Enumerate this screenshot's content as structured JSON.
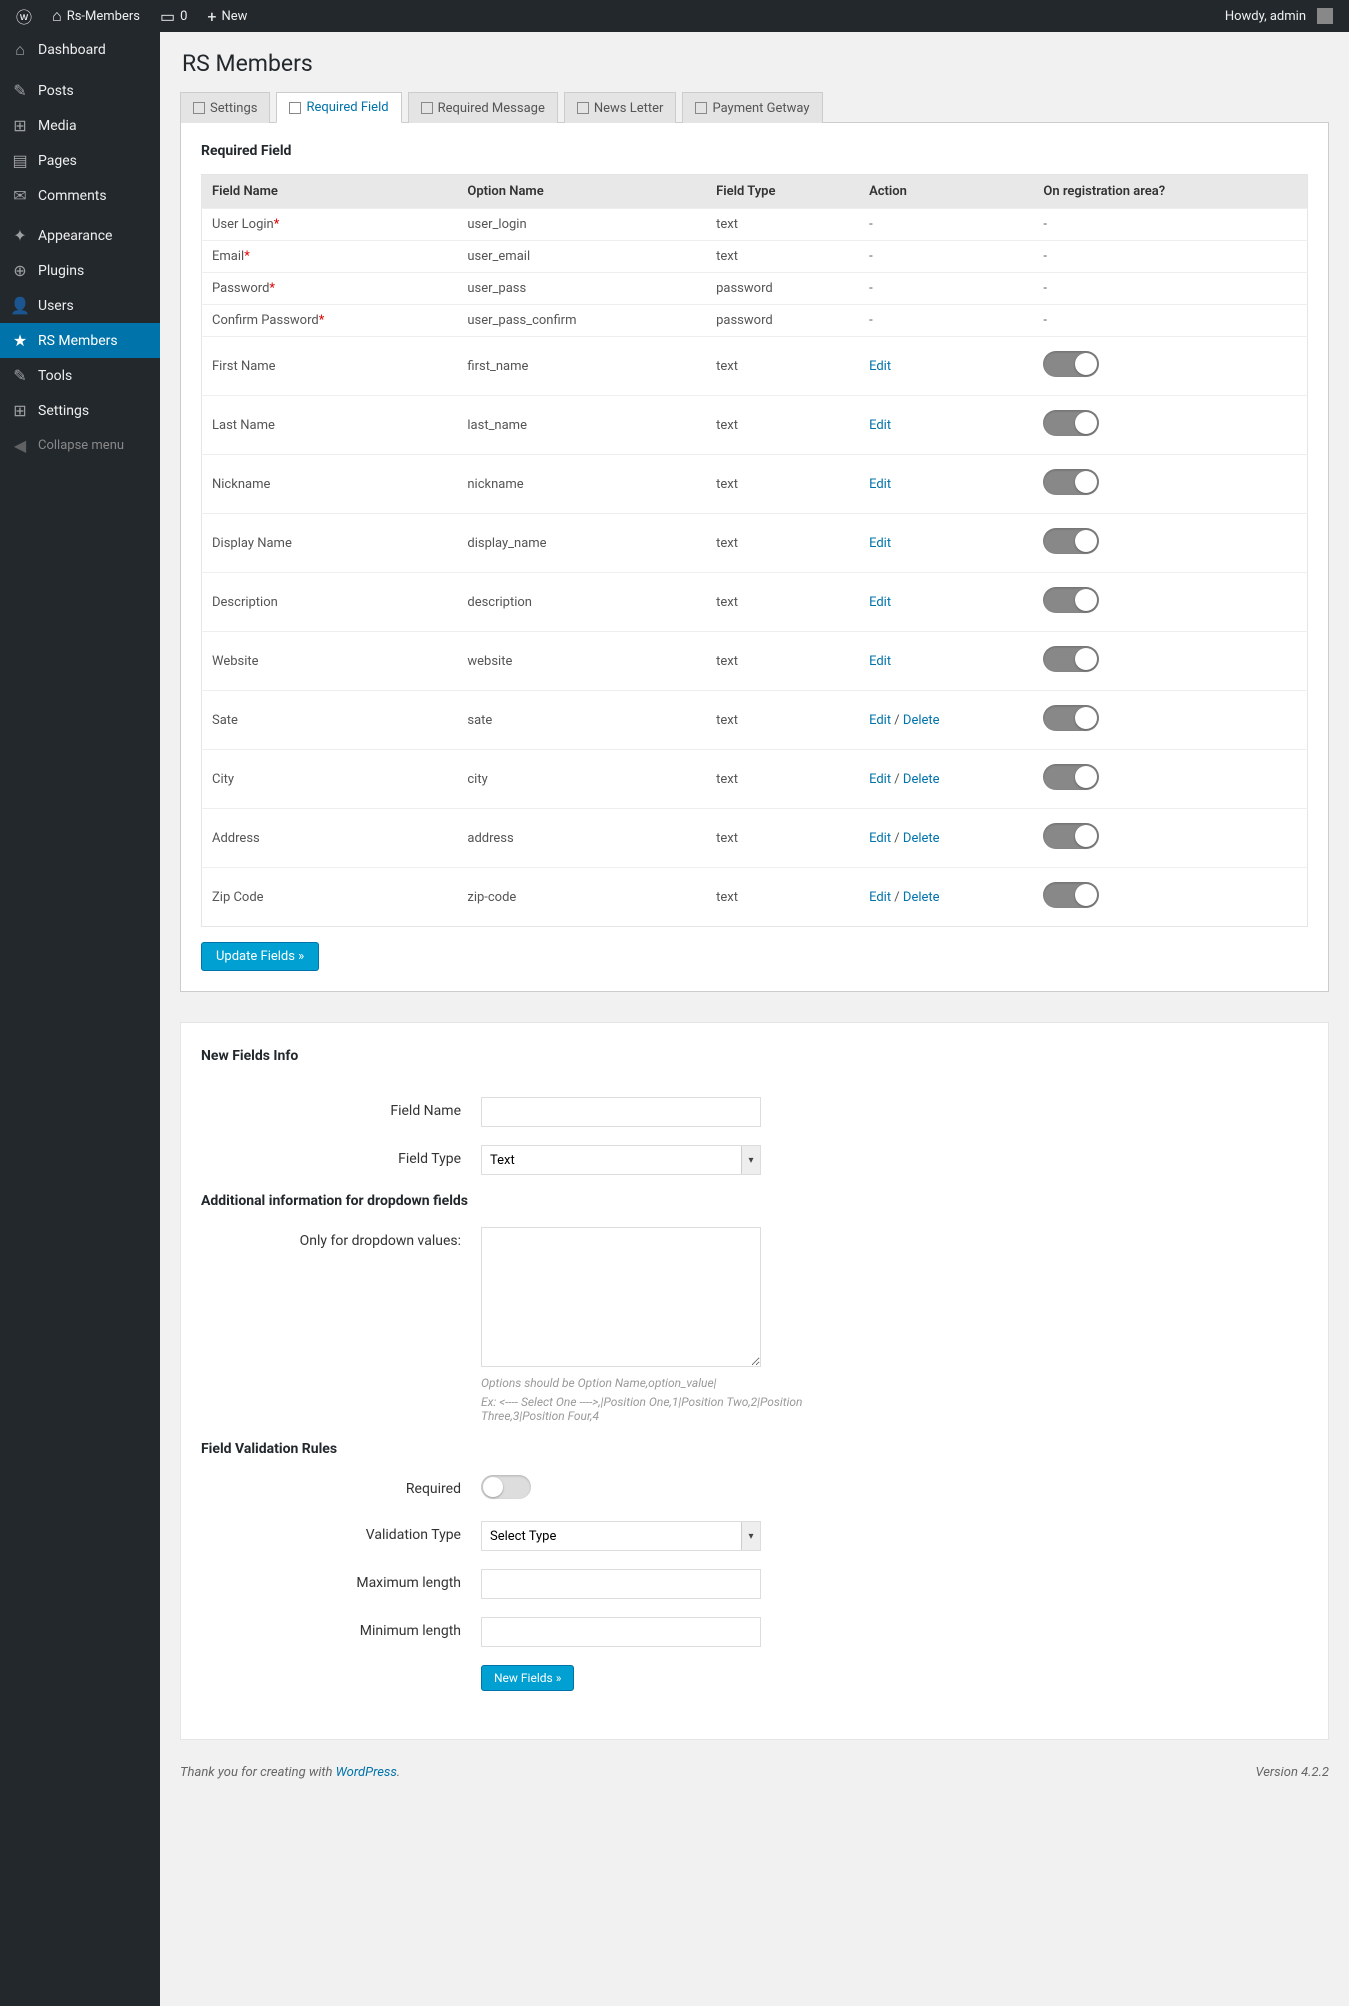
{
  "adminBar": {
    "siteName": "Rs-Members",
    "commentsCount": "0",
    "newLabel": "New",
    "howdy": "Howdy, admin"
  },
  "sidebar": {
    "items": [
      {
        "icon": "⌂",
        "label": "Dashboard",
        "name": "dashboard"
      },
      {
        "icon": "✎",
        "label": "Posts",
        "name": "posts",
        "sep": true
      },
      {
        "icon": "⊞",
        "label": "Media",
        "name": "media"
      },
      {
        "icon": "▤",
        "label": "Pages",
        "name": "pages"
      },
      {
        "icon": "✉",
        "label": "Comments",
        "name": "comments"
      },
      {
        "icon": "✦",
        "label": "Appearance",
        "name": "appearance",
        "sep": true
      },
      {
        "icon": "⊕",
        "label": "Plugins",
        "name": "plugins"
      },
      {
        "icon": "👤",
        "label": "Users",
        "name": "users"
      },
      {
        "icon": "★",
        "label": "RS Members",
        "name": "rs-members",
        "active": true
      },
      {
        "icon": "✎",
        "label": "Tools",
        "name": "tools"
      },
      {
        "icon": "⊞",
        "label": "Settings",
        "name": "settings"
      }
    ],
    "collapse": "Collapse menu"
  },
  "page": {
    "title": "RS Members"
  },
  "tabs": [
    {
      "label": "Settings",
      "active": false
    },
    {
      "label": "Required Field",
      "active": true
    },
    {
      "label": "Required Message",
      "active": false
    },
    {
      "label": "News Letter",
      "active": false
    },
    {
      "label": "Payment Getway",
      "active": false
    }
  ],
  "requiredField": {
    "heading": "Required Field",
    "columns": [
      "Field Name",
      "Option Name",
      "Field Type",
      "Action",
      "On registration area?"
    ],
    "rows": [
      {
        "name": "User Login",
        "req": true,
        "option": "user_login",
        "type": "text",
        "action": "-",
        "reg": "-"
      },
      {
        "name": "Email",
        "req": true,
        "option": "user_email",
        "type": "text",
        "action": "-",
        "reg": "-"
      },
      {
        "name": "Password",
        "req": true,
        "option": "user_pass",
        "type": "password",
        "action": "-",
        "reg": "-"
      },
      {
        "name": "Confirm Password",
        "req": true,
        "option": "user_pass_confirm",
        "type": "password",
        "action": "-",
        "reg": "-"
      },
      {
        "name": "First Name",
        "option": "first_name",
        "type": "text",
        "actions": [
          "Edit"
        ],
        "toggle": true
      },
      {
        "name": "Last Name",
        "option": "last_name",
        "type": "text",
        "actions": [
          "Edit"
        ],
        "toggle": true
      },
      {
        "name": "Nickname",
        "option": "nickname",
        "type": "text",
        "actions": [
          "Edit"
        ],
        "toggle": true
      },
      {
        "name": "Display Name",
        "option": "display_name",
        "type": "text",
        "actions": [
          "Edit"
        ],
        "toggle": true
      },
      {
        "name": "Description",
        "option": "description",
        "type": "text",
        "actions": [
          "Edit"
        ],
        "toggle": true
      },
      {
        "name": "Website",
        "option": "website",
        "type": "text",
        "actions": [
          "Edit"
        ],
        "toggle": true
      },
      {
        "name": "Sate",
        "option": "sate",
        "type": "text",
        "actions": [
          "Edit",
          "Delete"
        ],
        "toggle": true
      },
      {
        "name": "City",
        "option": "city",
        "type": "text",
        "actions": [
          "Edit",
          "Delete"
        ],
        "toggle": true
      },
      {
        "name": "Address",
        "option": "address",
        "type": "text",
        "actions": [
          "Edit",
          "Delete"
        ],
        "toggle": true
      },
      {
        "name": "Zip Code",
        "option": "zip-code",
        "type": "text",
        "actions": [
          "Edit",
          "Delete"
        ],
        "toggle": true
      }
    ],
    "updateBtn": "Update Fields »"
  },
  "newFields": {
    "heading": "New Fields Info",
    "fieldNameLabel": "Field Name",
    "fieldTypeLabel": "Field Type",
    "fieldTypeValue": "Text",
    "additionalHeading": "Additional information for dropdown fields",
    "dropdownLabel": "Only for dropdown values:",
    "dropdownHint1": "Options should be Option Name,option_value|",
    "dropdownHint2": "Ex: <---- Select One ---->,|Position One,1|Position Two,2|Position Three,3|Position Four,4",
    "validationHeading": "Field Validation Rules",
    "requiredLabel": "Required",
    "validationTypeLabel": "Validation Type",
    "validationTypeValue": "Select Type",
    "maxLenLabel": "Maximum length",
    "minLenLabel": "Minimum length",
    "newBtn": "New Fields »"
  },
  "footer": {
    "thanks": "Thank you for creating with ",
    "wp": "WordPress",
    "version": "Version 4.2.2"
  }
}
